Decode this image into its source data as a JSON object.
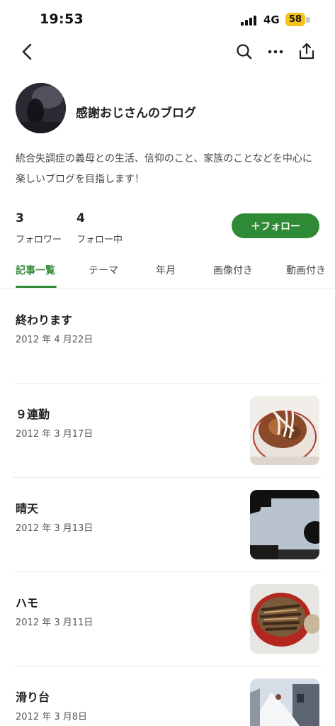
{
  "status_bar": {
    "time": "19:53",
    "network": "4G",
    "battery": "58"
  },
  "icons": {
    "back": "chevron-left-icon",
    "search": "search-icon",
    "more": "more-icon",
    "share": "share-icon"
  },
  "profile": {
    "title": "感謝おじさんのブログ",
    "description": "統合失調症の義母との生活、信仰のこと、家族のことなどを中心に楽しいブログを目指します！",
    "followers": {
      "count": "3",
      "label": "フォロワー"
    },
    "following": {
      "count": "4",
      "label": "フォロー中"
    },
    "follow_button": "＋フォロー"
  },
  "tabs": [
    {
      "label": "記事一覧",
      "active": true
    },
    {
      "label": "テーマ",
      "active": false
    },
    {
      "label": "年月",
      "active": false
    },
    {
      "label": "画像付き",
      "active": false
    },
    {
      "label": "動画付き",
      "active": false
    }
  ],
  "articles": [
    {
      "title": "終わります",
      "date": "2012 年 4 月22日",
      "has_image": false
    },
    {
      "title": "９連勤",
      "date": "2012 年 3 月17日",
      "has_image": true,
      "image": "rice-bowl-food-photo"
    },
    {
      "title": "晴天",
      "date": "2012 年 3 月13日",
      "has_image": true,
      "image": "sky-photo"
    },
    {
      "title": "ハモ",
      "date": "2012 年 3 月11日",
      "has_image": true,
      "image": "eel-bowl-photo"
    },
    {
      "title": "滑り台",
      "date": "2012 年 3 月8日",
      "has_image": true,
      "image": "snow-slide-photo"
    }
  ],
  "colors": {
    "accent": "#2f8a35",
    "battery": "#f4c21b"
  }
}
